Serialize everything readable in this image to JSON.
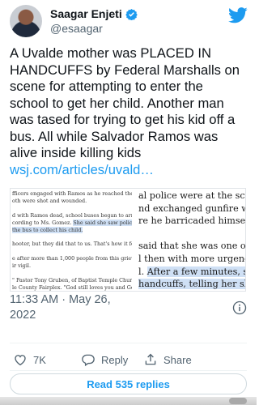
{
  "author": {
    "name": "Saagar Enjeti",
    "handle": "@esaagar"
  },
  "icons": {
    "verified": "verified-badge-icon",
    "platform": "twitter-bird-icon",
    "info": "info-icon",
    "like": "heart-icon",
    "reply": "reply-icon",
    "share": "share-icon"
  },
  "colors": {
    "accent": "#1d9bf0",
    "text": "#0f1419",
    "muted": "#536471",
    "highlight": "#cfe0f5"
  },
  "tweet": {
    "lines": [
      "A Uvalde mother was PLACED IN",
      "HANDCUFFS by Federal Marshalls on",
      "scene for attempting to enter the",
      "school to get her child. Another man",
      "was tased for trying to get his kid off a",
      "bus. All while Salvador Ramos was",
      "alive inside killing kids"
    ],
    "link": "wsj.com/articles/uvald…"
  },
  "article_image": {
    "left_lines": [
      {
        "text": "fficers engaged with Ramos as he reached the cl",
        "hl": ""
      },
      {
        "text": "oth were shot and wounded.",
        "hl": ""
      },
      {
        "text": "",
        "hl": ""
      },
      {
        "text": "d with Ramos dead, school buses began to arriv",
        "hl": ""
      },
      {
        "pre": "cording to Ms. Gomez. ",
        "hl": "She said she saw police u",
        "post": ""
      },
      {
        "pre": "",
        "hl": "the bus to collect his child.",
        "post": ""
      },
      {
        "text": "",
        "hl": ""
      },
      {
        "text": "hooter, but they did that to us. That's how it felt.",
        "hl": ""
      },
      {
        "text": "",
        "hl": ""
      },
      {
        "text": "e after more than 1,000 people from this grievin",
        "hl": ""
      },
      {
        "text": "ir vigil.",
        "hl": ""
      },
      {
        "text": "",
        "hl": ""
      },
      {
        "text": "\" Pastor Tony Gruben, of Baptist Temple Church",
        "hl": ""
      },
      {
        "text": "le County Fairplex. \"God still loves you and God",
        "hl": ""
      }
    ],
    "right_lines": [
      {
        "pre": "al police were at the school wi",
        "hl": "",
        "post": ""
      },
      {
        "pre": "nd exchanged gunfire with hir",
        "hl": "",
        "post": ""
      },
      {
        "pre": "re he barricaded himself, firing",
        "hl": "",
        "post": ""
      },
      {
        "pre": "",
        "hl": "",
        "post": ""
      },
      {
        "pre": "said that she was one of numer",
        "hl": "",
        "post": ""
      },
      {
        "pre": "l then with more urgency—pol",
        "hl": "",
        "post": ""
      },
      {
        "pre": "l. ",
        "hl": "After a few minutes, she said",
        "post": ""
      },
      {
        "pre": "",
        "hl": "handcuffs, telling her she was l",
        "post": ""
      }
    ]
  },
  "meta": {
    "time": "11:33 AM · May 26,",
    "year": "2022"
  },
  "actions": {
    "likes": "7K",
    "reply": "Reply",
    "share": "Share"
  },
  "read_replies": "Read 535 replies"
}
